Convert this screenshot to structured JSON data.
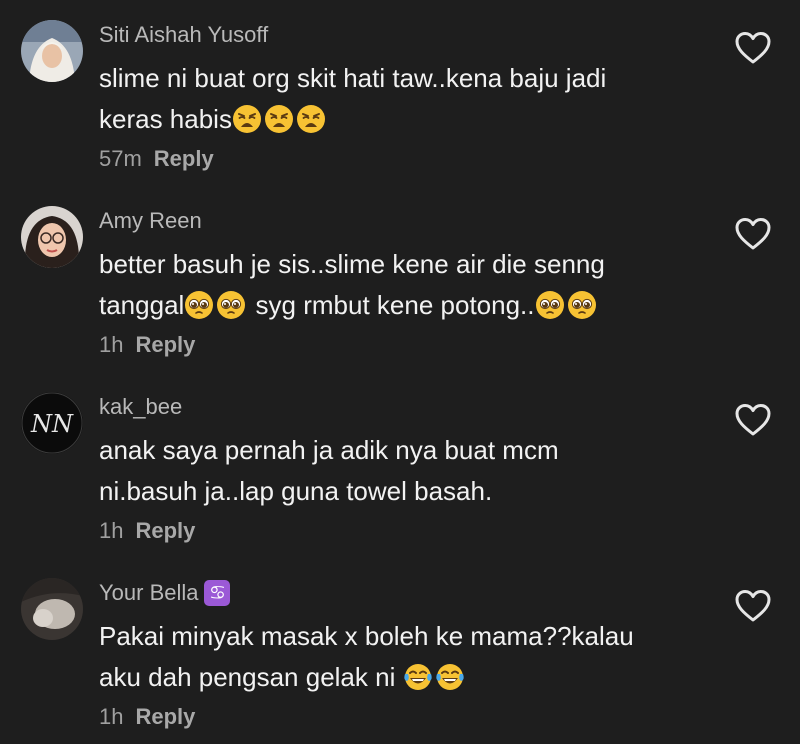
{
  "comments": [
    {
      "username": "Siti Aishah Yusoff",
      "line1": "slime ni buat org skit hati taw..kena baju jadi",
      "line2_text": "keras habis",
      "line2_emojis": [
        "weary-face-emoji",
        "weary-face-emoji",
        "weary-face-emoji"
      ],
      "time": "57m",
      "reply": "Reply"
    },
    {
      "username": "Amy Reen",
      "line1": "better basuh je sis..slime kene air die senng",
      "line2_a": "tanggal",
      "line2_b": "syg rmbut kene potong..",
      "time": "1h",
      "reply": "Reply"
    },
    {
      "username": "kak_bee",
      "avatar_text": "NN",
      "line1": "anak saya pernah ja adik nya buat mcm",
      "line2": "ni.basuh ja..lap guna towel basah.",
      "time": "1h",
      "reply": "Reply"
    },
    {
      "username": "Your Bella",
      "zodiac": "♋",
      "line1": "Pakai minyak masak x boleh ke mama??kalau",
      "line2_text": "aku dah pengsan gelak ni",
      "time": "1h",
      "reply": "Reply"
    }
  ],
  "colors": {
    "background": "#1e1e1e",
    "username": "#b9b9b9",
    "text": "#f2f2f2",
    "meta": "#a0a0a0",
    "heart_outline": "#e6e6e6",
    "zodiac_badge": "#9b59d6"
  }
}
